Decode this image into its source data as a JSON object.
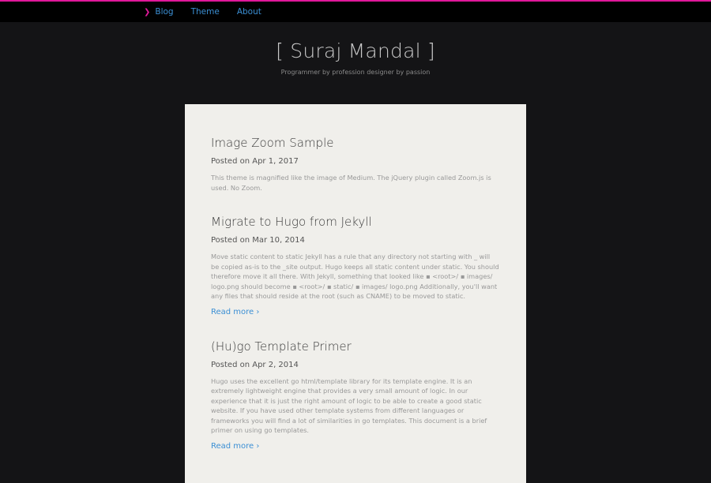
{
  "nav": {
    "active_icon": "chevron-right-icon",
    "items": [
      {
        "label": "Blog"
      },
      {
        "label": "Theme"
      },
      {
        "label": "About"
      }
    ]
  },
  "header": {
    "title": "[ Suraj Mandal ]",
    "subtitle": "Programmer by profession designer by passion"
  },
  "posts": [
    {
      "title": "Image Zoom Sample",
      "date": "Posted on Apr 1, 2017",
      "summary": "This theme is magnified like the image of Medium. The jQuery plugin called Zoom.js is used. No Zoom."
    },
    {
      "title": "Migrate to Hugo from Jekyll",
      "date": "Posted on Mar 10, 2014",
      "summary": "Move static content to static Jekyll has a rule that any directory not starting with _ will be copied as-is to the _site output. Hugo keeps all static content under static. You should therefore move it all there. With Jekyll, something that looked like ▪ <root>/ ▪ images/ logo.png should become ▪ <root>/ ▪ static/ ▪ images/ logo.png Additionally, you'll want any files that should reside at the root (such as CNAME) to be moved to static.",
      "read_more": "Read more ›"
    },
    {
      "title": "(Hu)go Template Primer",
      "date": "Posted on Apr 2, 2014",
      "summary": "Hugo uses the excellent go html/template library for its template engine. It is an extremely lightweight engine that provides a very small amount of logic. In our experience that it is just the right amount of logic to be able to create a good static website. If you have used other template systems from different languages or frameworks you will find a lot of similarities in go templates. This document is a brief primer on using go templates.",
      "read_more": "Read more ›"
    }
  ],
  "colors": {
    "accent": "#e0189a",
    "link": "#3b8fd4",
    "background": "#141416",
    "card": "#f0efeb"
  }
}
